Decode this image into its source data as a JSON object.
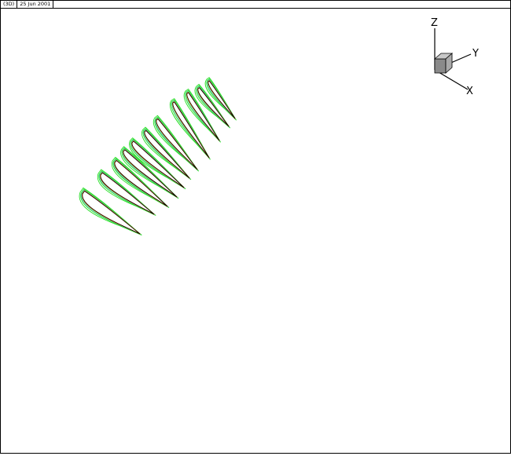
{
  "header": {
    "mode_label": "(3D)",
    "date_label": "25 Jun 2001"
  },
  "axis_triad": {
    "z_label": "Z",
    "y_label": "Y",
    "x_label": "X",
    "cube_color": "#9a9a9a"
  },
  "colors": {
    "outer_contour": "#22dd22",
    "mid_contour": "#1fb8d8",
    "inner_contour": "#ff3b1a",
    "accent_contour": "#ffd400",
    "airfoil_outline": "#000000"
  }
}
